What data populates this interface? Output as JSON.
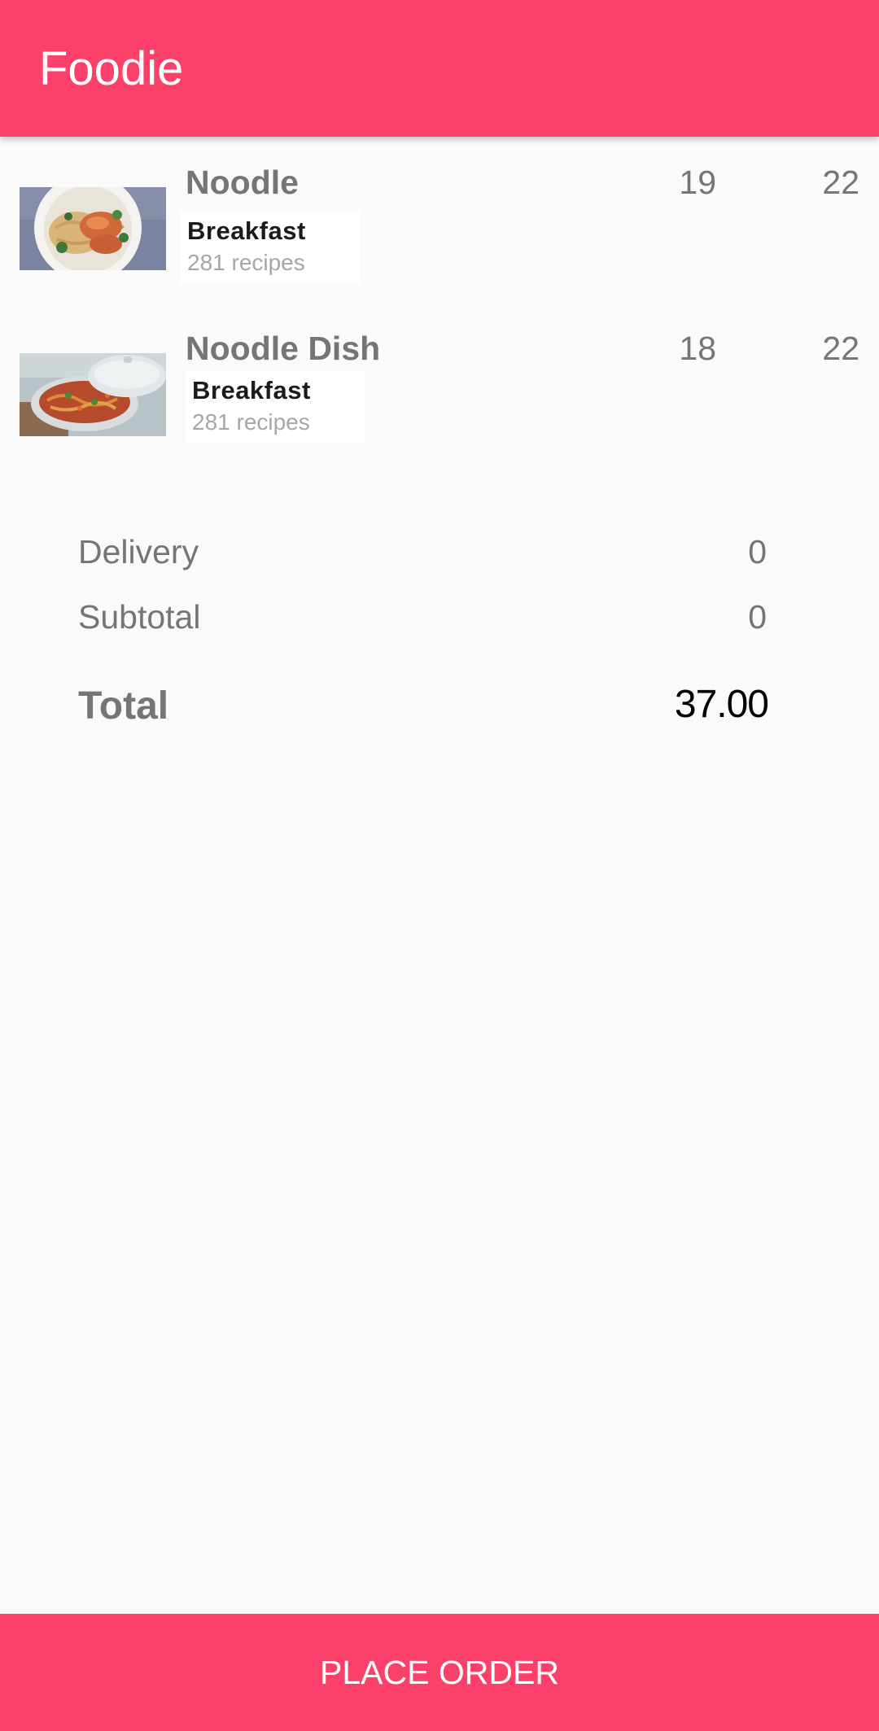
{
  "app_bar": {
    "title": "Foodie",
    "color": "#fb4069"
  },
  "cart_items": [
    {
      "name": "Noodle",
      "quantity": "19",
      "price": "22",
      "category": "Breakfast",
      "recipe_count": "281 recipes",
      "image": "noodle-bowl-photo"
    },
    {
      "name": "Noodle Dish",
      "quantity": "18",
      "price": "22",
      "category": "Breakfast",
      "recipe_count": "281 recipes",
      "image": "noodle-pan-photo"
    }
  ],
  "summary": {
    "delivery_label": "Delivery",
    "delivery_value": "0",
    "subtotal_label": "Subtotal",
    "subtotal_value": "0",
    "total_label": "Total",
    "total_value": "37.00"
  },
  "place_order_button": {
    "label": "PLACE ORDER"
  }
}
